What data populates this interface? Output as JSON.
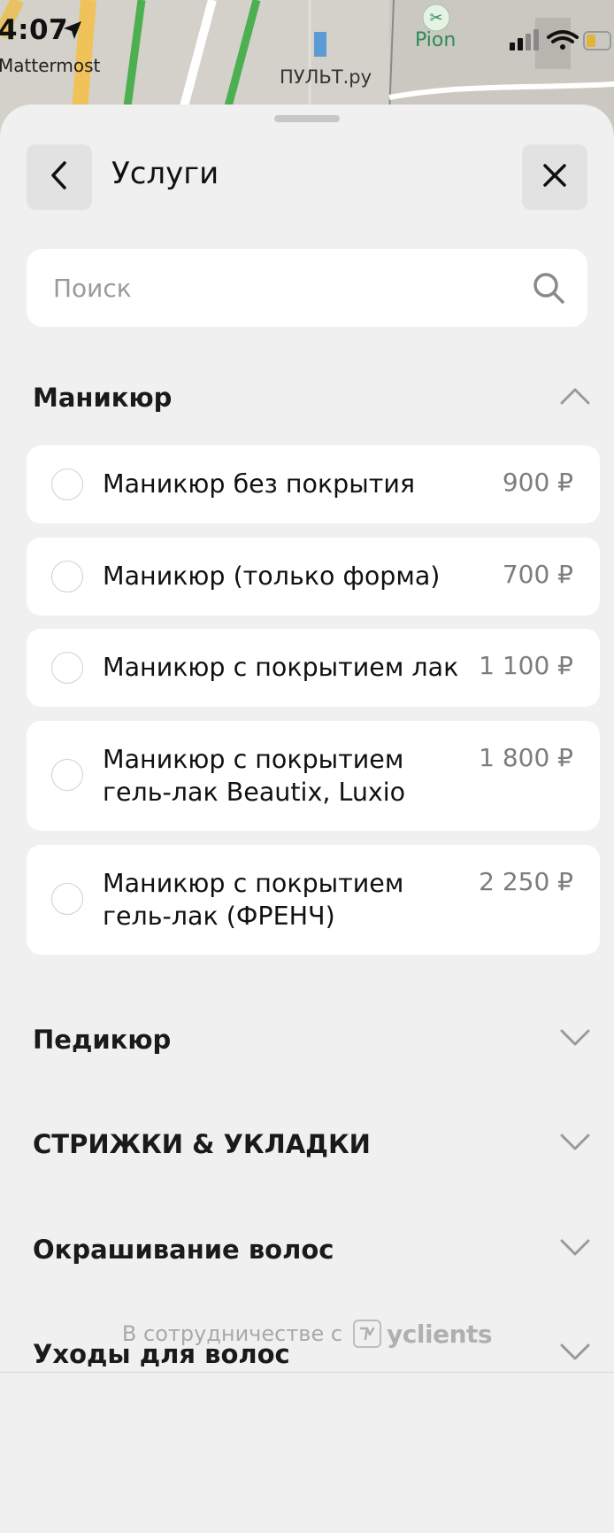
{
  "status_bar": {
    "time": "4:07",
    "app_back": "Mattermost"
  },
  "map": {
    "label_pult": "ПУЛЬТ.ру",
    "label_pion": "Pion"
  },
  "header": {
    "title": "Услуги"
  },
  "search": {
    "placeholder": "Поиск",
    "value": ""
  },
  "categories": [
    {
      "label": "Маникюр",
      "expanded": true
    },
    {
      "label": "Педикюр",
      "expanded": false
    },
    {
      "label": "СТРИЖКИ & УКЛАДКИ",
      "expanded": false
    },
    {
      "label": "Окрашивание волос",
      "expanded": false
    },
    {
      "label": "Уходы для волос",
      "expanded": false
    }
  ],
  "services": [
    {
      "name": "Маникюр без покрытия",
      "price": "900 ₽"
    },
    {
      "name": "Маникюр (только форма)",
      "price": "700 ₽"
    },
    {
      "name": "Маникюр с покрытием лак",
      "price": "1 100 ₽"
    },
    {
      "name": "Маникюр с покрытием гель-лак Beautix, Luxio",
      "price": "1 800 ₽"
    },
    {
      "name": "Маникюр с покрытием гель-лак (ФРЕНЧ)",
      "price": "2 250 ₽"
    }
  ],
  "footer": {
    "partner_text": "В сотрудничестве с",
    "brand": "yclients"
  },
  "colors": {
    "sheet_bg": "#f0f0f0",
    "card_bg": "#ffffff",
    "price": "#7d7d7d",
    "button_bg": "#e2e2e2"
  }
}
